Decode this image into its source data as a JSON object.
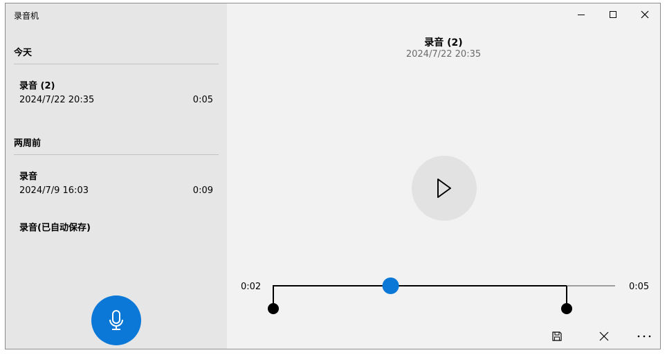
{
  "app": {
    "title": "录音机"
  },
  "sidebar": {
    "groups": [
      {
        "header": "今天",
        "items": [
          {
            "name": "录音 (2)",
            "date": "2024/7/22 20:35",
            "duration": "0:05"
          }
        ]
      },
      {
        "header": "两周前",
        "items": [
          {
            "name": "录音",
            "date": "2024/7/9 16:03",
            "duration": "0:09"
          },
          {
            "name": "录音(已自动保存)"
          }
        ]
      }
    ],
    "record_button_icon": "microphone-icon"
  },
  "detail": {
    "title": "录音 (2)",
    "date": "2024/7/22 20:35",
    "current_time": "0:02",
    "total_time": "0:05",
    "playback_progress": 0.4,
    "trim_start_fraction": 0.0,
    "trim_end_fraction": 1.0
  },
  "toolbar": {
    "icons": [
      "save-icon",
      "close-icon",
      "more-icon"
    ]
  },
  "titlebar": {
    "icons": [
      "minimize-icon",
      "maximize-icon",
      "close-icon"
    ]
  },
  "colors": {
    "accent": "#0b78d7",
    "sidebar_bg": "#e6e6e6",
    "main_bg": "#f2f2f2"
  }
}
